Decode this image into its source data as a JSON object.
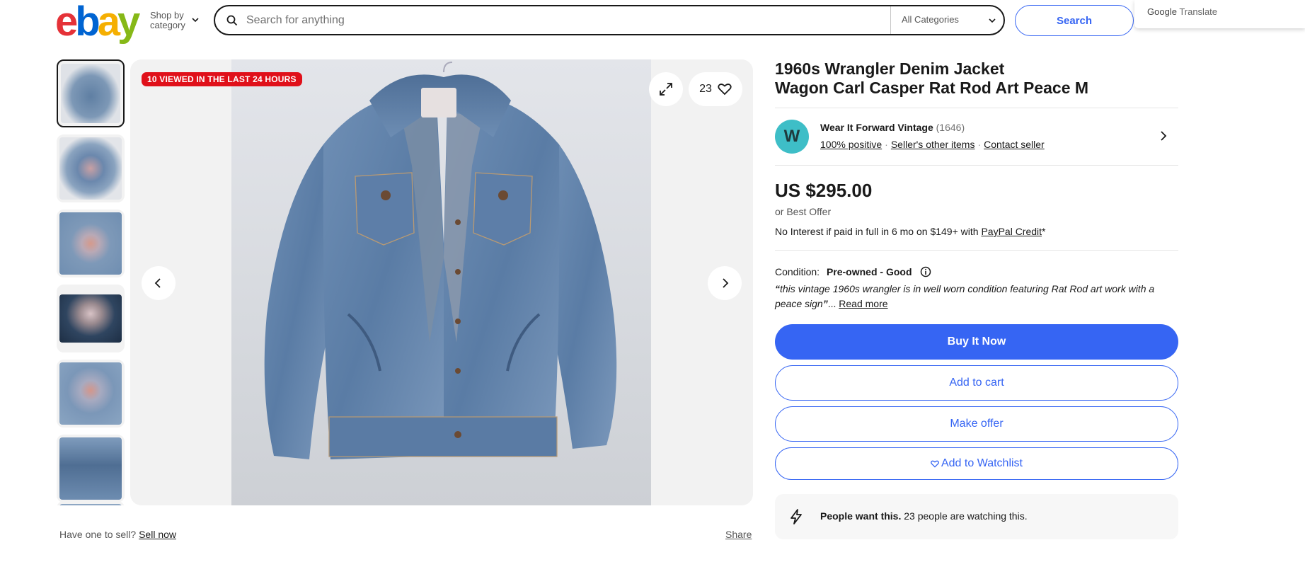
{
  "header": {
    "logo_letters": [
      "e",
      "b",
      "a",
      "y"
    ],
    "logo_colors": [
      "#e53238",
      "#0064d2",
      "#f5af02",
      "#86b817"
    ],
    "shop_by_line1": "Shop by",
    "shop_by_line2": "category",
    "search_placeholder": "Search for anything",
    "category_select": "All Categories",
    "search_button": "Search",
    "google_translate_brand": "Google",
    "google_translate_label": "Translate"
  },
  "gallery": {
    "viewed_badge": "10 VIEWED IN THE LAST 24 HOURS",
    "watch_count": "23",
    "thumbnail_count": 7,
    "accent_badge_color": "#e0101a"
  },
  "footer": {
    "have_one": "Have one to sell?",
    "sell_now": "Sell now",
    "share": "Share"
  },
  "listing": {
    "title_line1": "1960s Wrangler Denim Jacket",
    "title_line2": "Wagon Carl Casper Rat Rod Art Peace M",
    "seller": {
      "avatar_letter": "W",
      "name": "Wear It Forward Vintage",
      "feedback_count": "(1646)",
      "positive": "100% positive",
      "other_items": "Seller's other items",
      "contact": "Contact seller"
    },
    "price": "US $295.00",
    "best_offer": "or Best Offer",
    "credit_text": "No Interest if paid in full in 6 mo on $149+ with",
    "credit_link": "PayPal Credit",
    "credit_suffix": "*",
    "condition_label": "Condition:",
    "condition_value": "Pre-owned - Good",
    "quote_open": "“",
    "quote_text": "this vintage 1960s wrangler is in well worn condition featuring Rat Rod art work with a peace sign",
    "quote_close": "”",
    "ellipsis": "...",
    "read_more": "Read more",
    "buy_now": "Buy It Now",
    "add_to_cart": "Add to cart",
    "make_offer": "Make offer",
    "add_to_watchlist": "Add to Watchlist",
    "people_bold": "People want this.",
    "people_text": "23 people are watching this.",
    "primary_color": "#3665f3"
  }
}
